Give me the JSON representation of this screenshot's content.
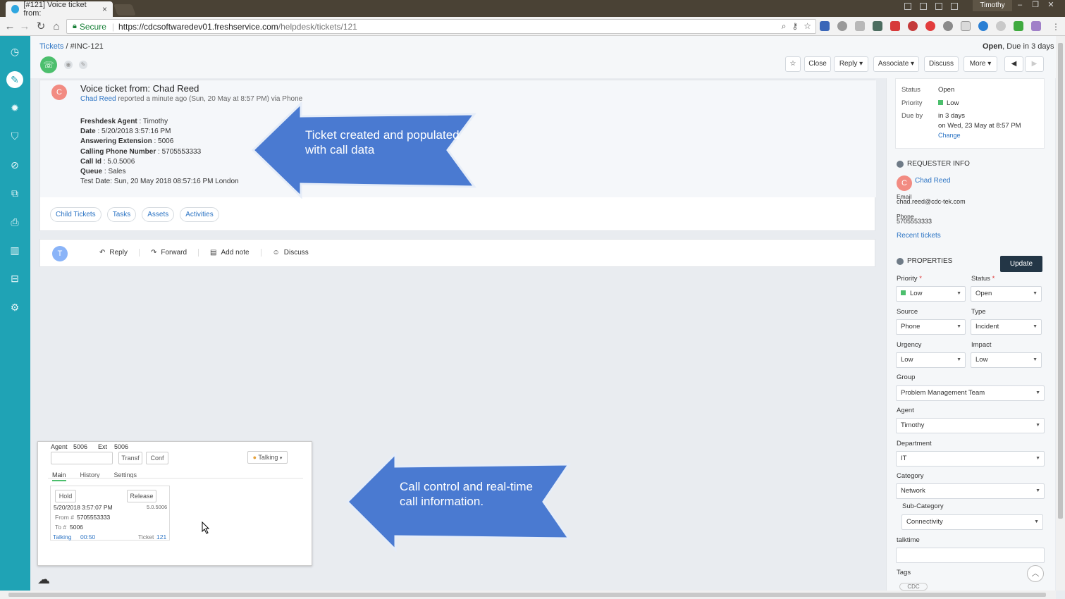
{
  "browser": {
    "tab_title": "[#121] Voice ticket from:",
    "tab_close": "×",
    "user_label": "Timothy",
    "secure_label": "Secure",
    "url_host": "https://cdcsoftwaredev01.freshservice.com",
    "url_path": "/helpdesk/tickets/121"
  },
  "header": {
    "breadcrumb_link": "Tickets",
    "breadcrumb_rest": " / #INC-121",
    "status_bold": "Open",
    "status_due": ", Due in 3 days",
    "toolbar": {
      "close": "Close",
      "reply": "Reply ▾",
      "associate": "Associate ▾",
      "discuss": "Discuss",
      "more": "More ▾"
    }
  },
  "ticket": {
    "avatar": "C",
    "title": "Voice ticket from: Chad Reed",
    "requester_link": "Chad Reed",
    "meta": " reported a minute ago (Sun, 20 May at 8:57 PM) via Phone",
    "fields": [
      {
        "label": "Freshdesk Agent",
        "value": " : Timothy"
      },
      {
        "label": "Date",
        "value": " : 5/20/2018 3:57:16 PM"
      },
      {
        "label": "Answering Extension",
        "value": " : 5006"
      },
      {
        "label": "Calling Phone Number",
        "value": " : 5705553333"
      },
      {
        "label": "Call Id",
        "value": " : 5.0.5006"
      },
      {
        "label": "Queue",
        "value": " : Sales"
      }
    ],
    "test_date": "Test Date: Sun, 20 May 2018 08:57:16 PM London",
    "tabs": [
      "Child Tickets",
      "Tasks",
      "Assets",
      "Activities"
    ]
  },
  "reply_bar": {
    "avatar": "T",
    "reply": "Reply",
    "forward": "Forward",
    "add_note": "Add note",
    "discuss": "Discuss"
  },
  "callouts": {
    "top": "Ticket created and populated with call data",
    "bottom": "Call control and real-time call information."
  },
  "call_widget": {
    "agent_label": "Agent",
    "agent_value": "5006",
    "ext_label": "Ext",
    "ext_value": "5006",
    "transfer": "Transf",
    "conf": "Conf",
    "status": "Talking",
    "tabs": [
      "Main",
      "History",
      "Settings"
    ],
    "hold": "Hold",
    "release": "Release",
    "call_time": "5/20/2018 3:57:07 PM",
    "call_id": "5.0.5006",
    "from_label": "From #",
    "from_value": "5705553333",
    "to_label": "To #",
    "to_value": "5006",
    "state": "Talking",
    "duration": "00:50",
    "ticket_label": "Ticket",
    "ticket_value": "121"
  },
  "status_card": {
    "status_label": "Status",
    "status_value": "Open",
    "priority_label": "Priority",
    "priority_value": "Low",
    "due_label": "Due by",
    "due_value": "in 3 days",
    "due_date": "on Wed, 23 May at 8:57 PM",
    "change": "Change"
  },
  "requester": {
    "heading": "REQUESTER INFO",
    "avatar": "C",
    "name": "Chad Reed",
    "email_label": "Email",
    "email": "chad.reed@cdc-tek.com",
    "phone_label": "Phone",
    "phone": "5705553333",
    "recent": "Recent tickets"
  },
  "properties": {
    "heading": "PROPERTIES",
    "update": "Update",
    "priority_label": "Priority",
    "priority": "Low",
    "status_label": "Status",
    "status": "Open",
    "source_label": "Source",
    "source": "Phone",
    "type_label": "Type",
    "type": "Incident",
    "urgency_label": "Urgency",
    "urgency": "Low",
    "impact_label": "Impact",
    "impact": "Low",
    "group_label": "Group",
    "group": "Problem Management Team",
    "agent_label": "Agent",
    "agent": "Timothy",
    "department_label": "Department",
    "department": "IT",
    "category_label": "Category",
    "category": "Network",
    "subcategory_label": "Sub-Category",
    "subcategory": "Connectivity",
    "talktime_label": "talktime",
    "tags_label": "Tags",
    "tag": "CDC"
  },
  "colors": {
    "nav": "#1fa3b5",
    "accent_green": "#4cbf6d",
    "link": "#2c74c4",
    "callout": "#4a7ad1",
    "update_btn": "#233646"
  }
}
